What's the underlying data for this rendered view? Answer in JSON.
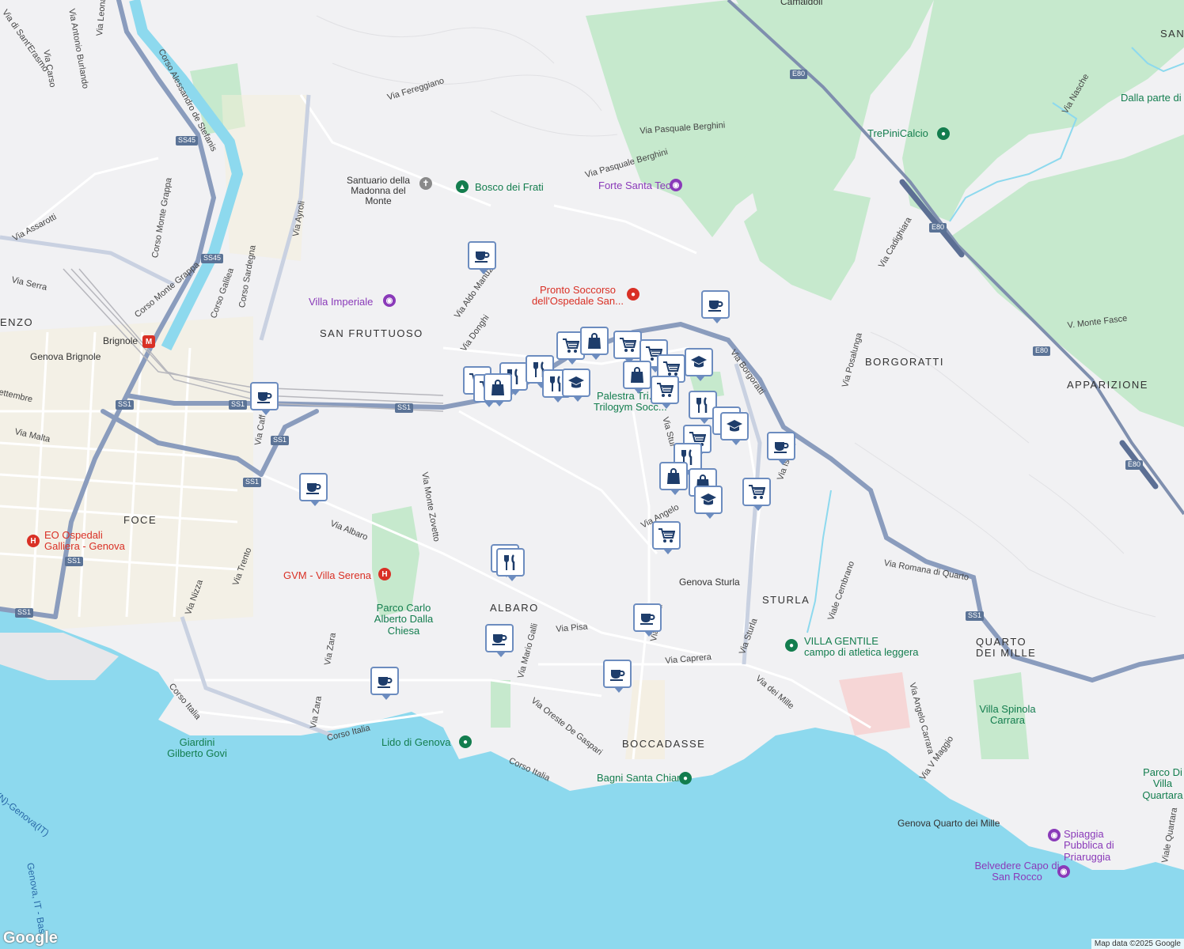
{
  "map": {
    "provider_logo": "Google",
    "attribution": "Map data ©2025 Google",
    "colors": {
      "sea": "#8dd9ee",
      "land": "#f1f1f3",
      "park": "#c6e9cd",
      "highway": "#8a9cbd",
      "road": "#ffffff",
      "marker_border": "#6c8cbf",
      "marker_icon": "#1e3d6b"
    }
  },
  "districts": [
    "SAN FRUTTUOSO",
    "FOCE",
    "ALBARO",
    "STURLA",
    "BOCCADASSE",
    "BORGORATTI",
    "APPARIZIONE",
    "QUARTO",
    "DEI MILLE",
    "ENZO",
    "SAN",
    "Camaldoli"
  ],
  "roads": [
    "Corso Alessandro de Stefanis",
    "Via Leonardo",
    "Via Antonio Burlando",
    "Via di Sant'Erasmo",
    "Via Carso",
    "Via Fereggiano",
    "Via Pasquale Berghini",
    "Via Pasquale Berghini",
    "Via Assarotti",
    "Corso Monte Grappa",
    "Corso Monte Grappa",
    "Via Ayroli",
    "Corso Sardegna",
    "Corso Galilea",
    "Via Serra",
    "Via Aldo Manuzio",
    "Via Donghi",
    "Via Borgoratti",
    "Via Posalunga",
    "Via Cadighiara",
    "V. Monte Fasce",
    "Via Nasche",
    "Via Malta",
    "Via Monte Zovetto",
    "Via Albaro",
    "Via Trento",
    "Via Nizza",
    "Via Zara",
    "Via Zara",
    "Via Mario Galli",
    "Via Pisa",
    "Via Caprera",
    "Via Angelo",
    "Via Orsini",
    "Via Sturla",
    "Via dei Mille",
    "Viale Cembrano",
    "Via Romana di Quarto",
    "Via Angelo Carrara",
    "Via V Maggio",
    "Corso Italia",
    "Corso Italia",
    "Corso Italia",
    "Via Oreste De Gaspari",
    "Viale Quartara",
    "Via Isonzo",
    "Via Stur",
    "Via Caff",
    "ettembre"
  ],
  "road_shields": [
    "SS45",
    "SS45",
    "SS1",
    "SS1",
    "SS1",
    "SS1",
    "SS1",
    "SS1",
    "SS1",
    "SS1",
    "E80",
    "E80",
    "E80",
    "E80"
  ],
  "pois": {
    "green": [
      "Bosco dei Frati",
      "TrePiniCalcio",
      "Lido di Genova",
      "Bagni Santa Chiara",
      "Parco Carlo Alberto Dalla Chiesa",
      "Giardini Gilberto Govi",
      "Parco Di Villa Quartara",
      "Villa Spinola Carrara",
      "Dalla parte di"
    ],
    "purple": [
      "Forte Santa Tecla",
      "Villa Imperiale",
      "Santuario della Madonna del Monte",
      "Spiaggia Pubblica di Priaruggia",
      "Belvedere Capo di San Rocco"
    ],
    "red": [
      "Pronto Soccorso dell'Ospedale San...",
      "EO Ospedali Galliera - Genova",
      "GVM - Villa Serena"
    ],
    "teal": [
      "VILLA GENTILE",
      "campo di atletica leggera",
      "Palestra Tri...",
      "Trilogym Socc..."
    ],
    "transit": [
      "Brignole",
      "Genova Brignole",
      "Genova Sturla",
      "Genova Quarto dei Mille"
    ],
    "water": [
      "Genova, IT - Bas",
      "(N)-Genova(IT)"
    ]
  },
  "markers": [
    {
      "icon": "cafe-icon"
    },
    {
      "icon": "cafe-icon"
    },
    {
      "icon": "cafe-icon"
    },
    {
      "icon": "cafe-icon"
    },
    {
      "icon": "cafe-icon"
    },
    {
      "icon": "cafe-icon"
    },
    {
      "icon": "cafe-icon"
    },
    {
      "icon": "cafe-icon"
    },
    {
      "icon": "cafe-icon"
    },
    {
      "icon": "shopping-cart-icon"
    },
    {
      "icon": "shopping-cart-icon"
    },
    {
      "icon": "shopping-cart-icon"
    },
    {
      "icon": "shopping-cart-icon"
    },
    {
      "icon": "shopping-cart-icon"
    },
    {
      "icon": "shopping-cart-icon"
    },
    {
      "icon": "shopping-cart-icon"
    },
    {
      "icon": "shopping-cart-icon"
    },
    {
      "icon": "shopping-cart-icon"
    },
    {
      "icon": "shopping-cart-icon"
    },
    {
      "icon": "restaurant-icon"
    },
    {
      "icon": "restaurant-icon"
    },
    {
      "icon": "restaurant-icon"
    },
    {
      "icon": "restaurant-icon"
    },
    {
      "icon": "restaurant-icon"
    },
    {
      "icon": "restaurant-icon"
    },
    {
      "icon": "restaurant-icon"
    },
    {
      "icon": "shopping-bag-icon"
    },
    {
      "icon": "shopping-bag-icon"
    },
    {
      "icon": "shopping-bag-icon"
    },
    {
      "icon": "shopping-bag-icon"
    },
    {
      "icon": "shopping-bag-icon"
    },
    {
      "icon": "shopping-bag-icon"
    },
    {
      "icon": "school-icon"
    },
    {
      "icon": "school-icon"
    },
    {
      "icon": "school-icon"
    },
    {
      "icon": "school-icon"
    }
  ]
}
